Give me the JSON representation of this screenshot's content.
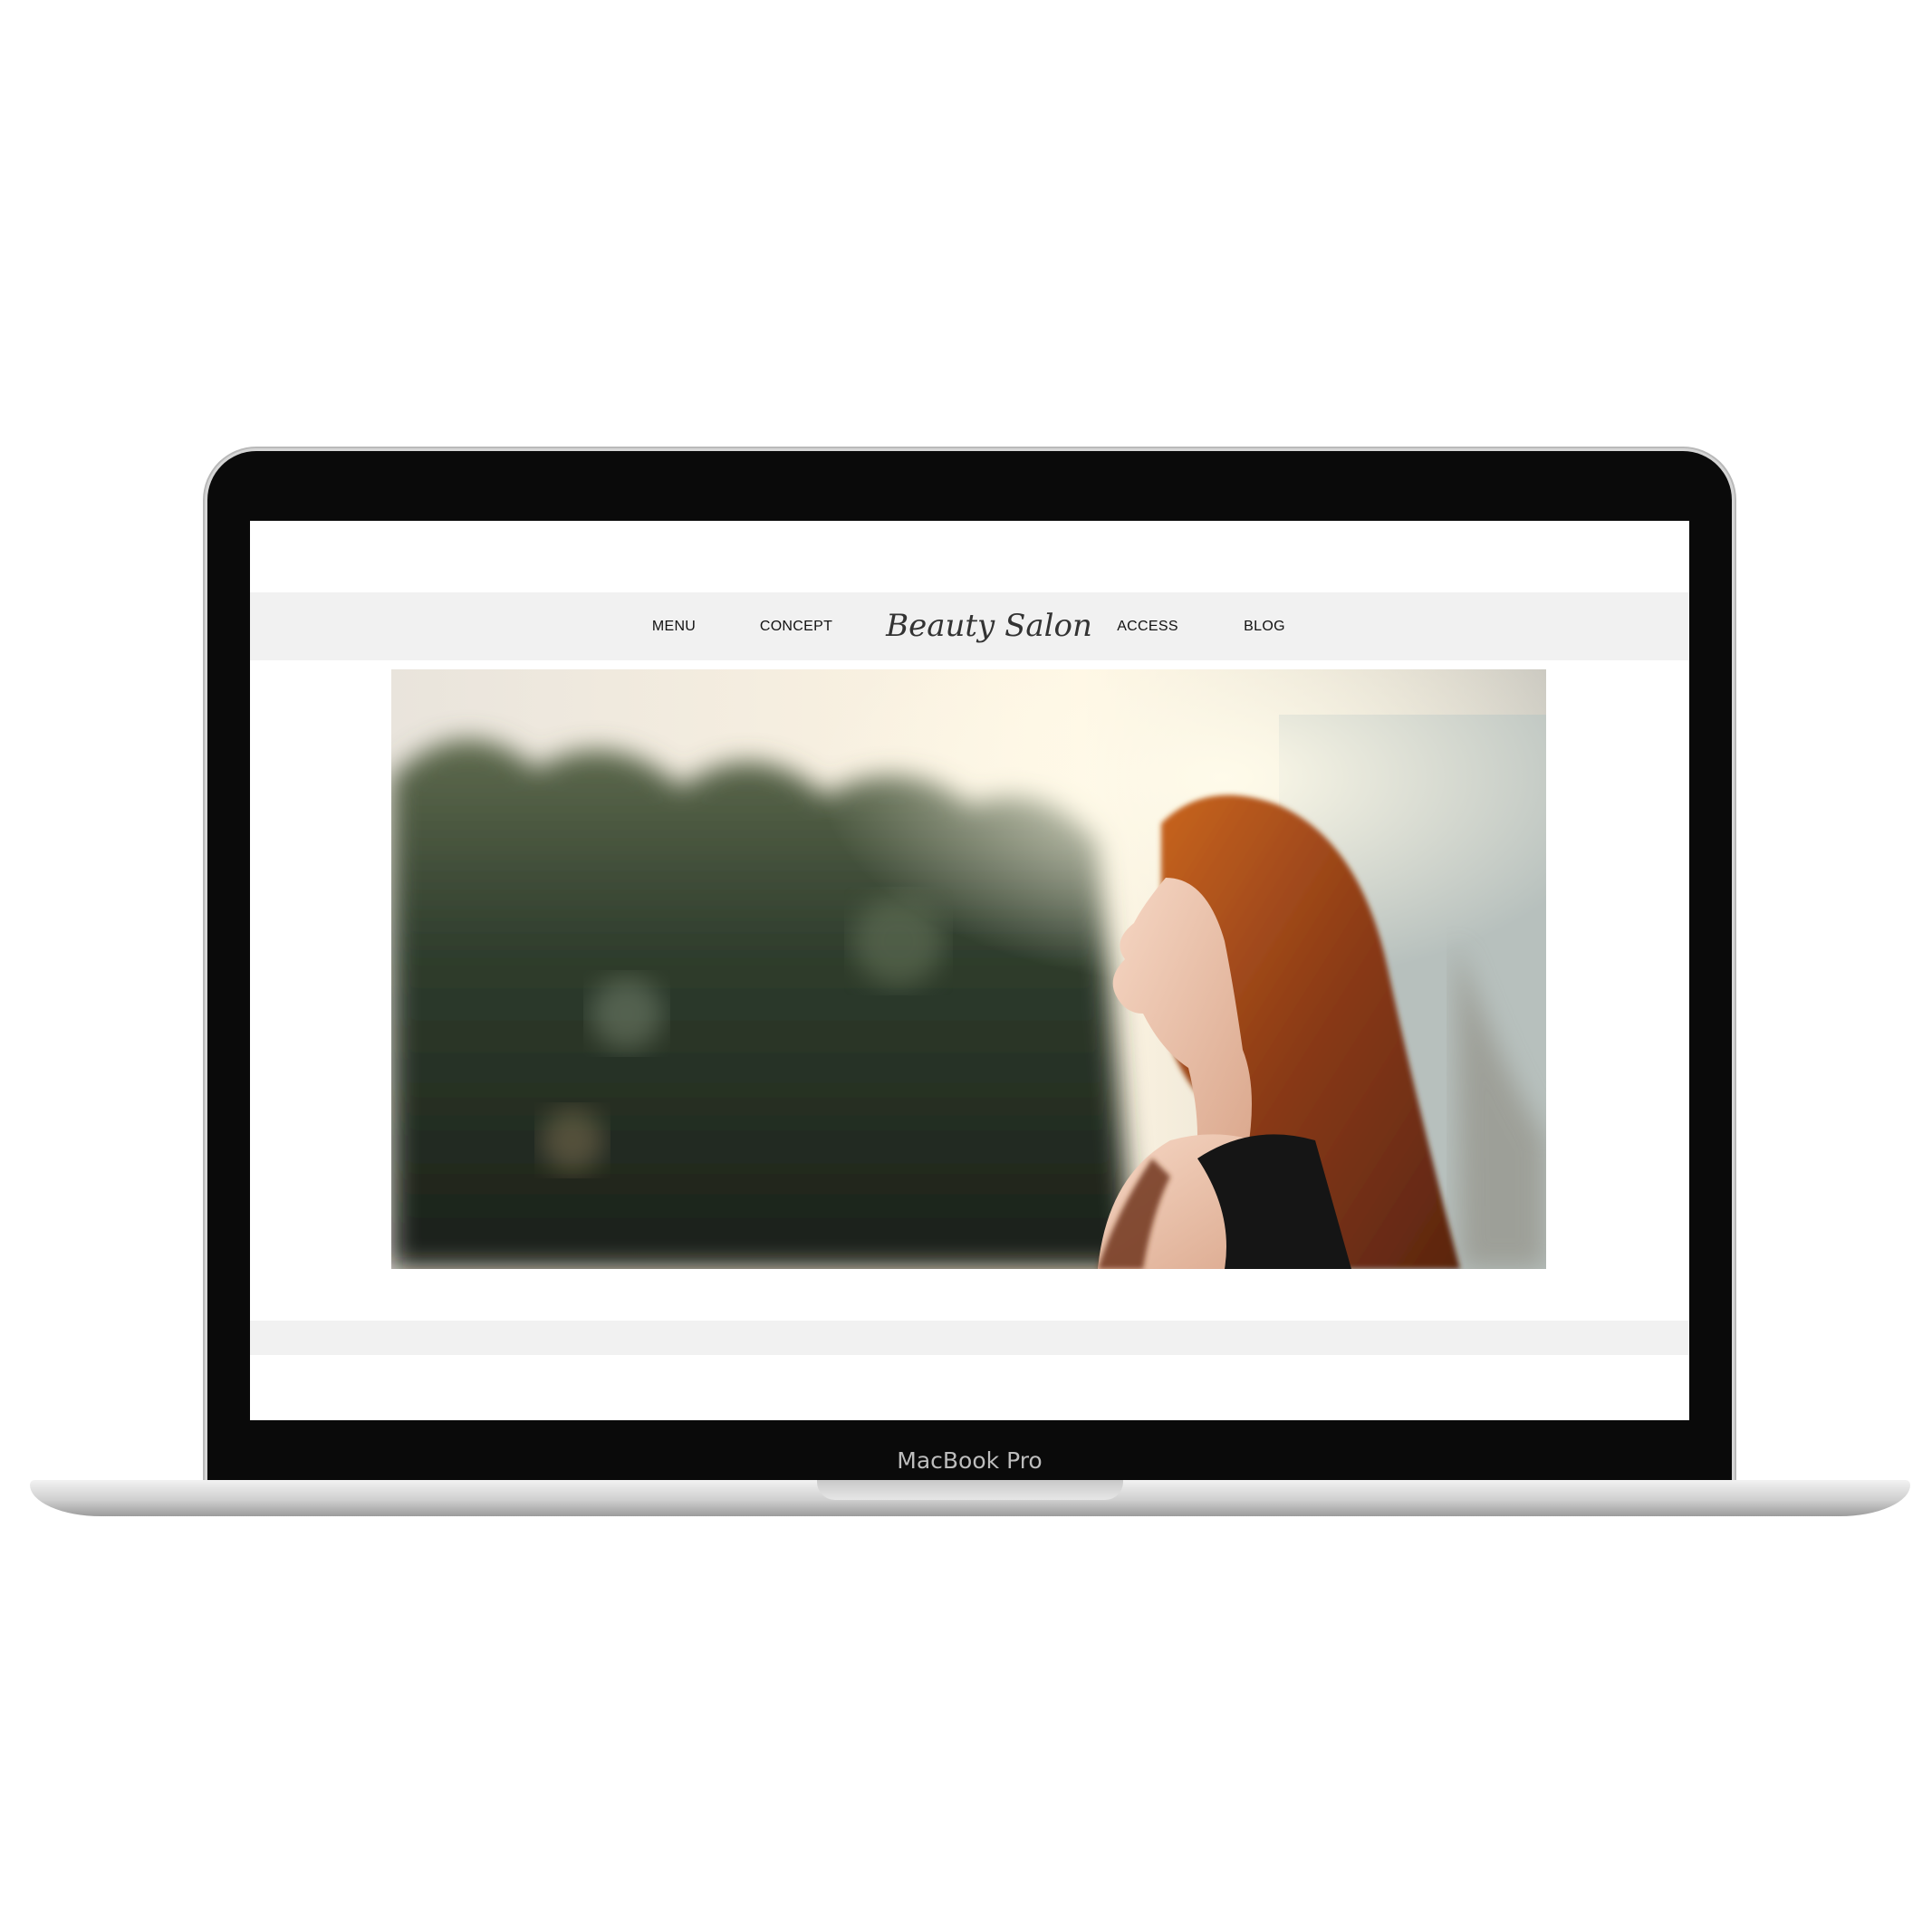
{
  "nav": {
    "items_left": [
      "MENU",
      "CONCEPT"
    ],
    "logo": "Beauty Salon",
    "items_right": [
      "ACCESS",
      "BLOG"
    ]
  },
  "hero": {
    "image": "portrait of woman with long auburn hair, eyes closed, sunlit, blurred greenery background"
  },
  "device": {
    "label": "MacBook Pro"
  },
  "colors": {
    "nav_background": "#f1f1f1",
    "text": "#111111",
    "bezel": "#0a0a0a"
  }
}
